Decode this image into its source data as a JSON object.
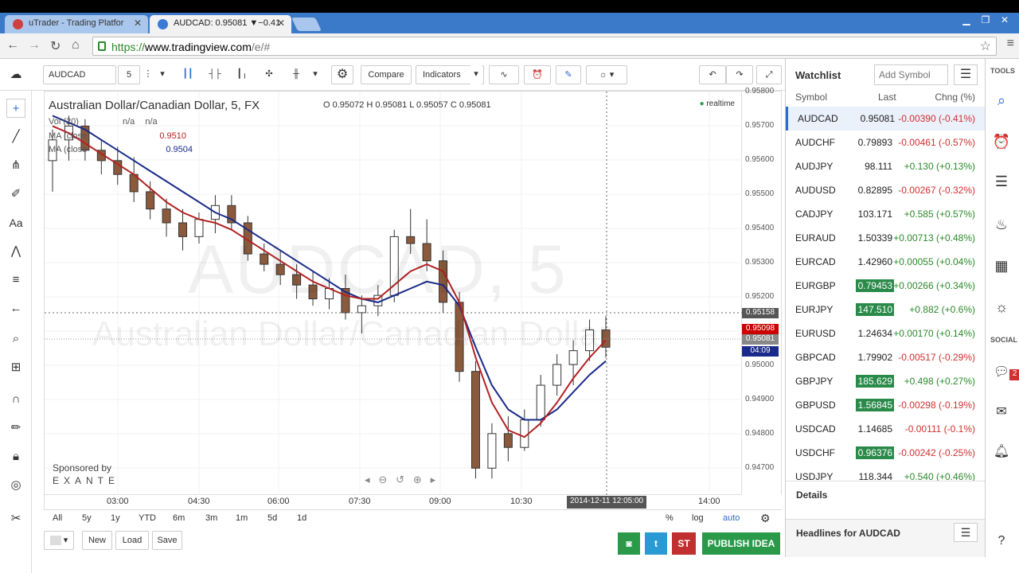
{
  "browser": {
    "tabs": [
      {
        "label": "uTrader - Trading Platfor"
      },
      {
        "label": "AUDCAD: 0.95081 ▼−0.41"
      }
    ],
    "url_proto": "https://",
    "url_host": "www.tradingview.com",
    "url_rest": "/e/#"
  },
  "toolbar": {
    "symbol": "AUDCAD",
    "interval": "5",
    "compare_label": "Compare",
    "indicators_label": "Indicators"
  },
  "legend": {
    "title": "Australian Dollar/Canadian Dollar, 5, FX",
    "ohlc": "O 0.95072 H 0.95081 L 0.95057 C 0.95081",
    "realtime": "realtime",
    "vol_label": "Vol (20)",
    "vol_val1": "n/a",
    "vol_val2": "n/a",
    "ma1_label": "MA (close",
    "ma1_val": "0.9510",
    "ma2_label": "MA (close",
    "ma2_val": "0.9504",
    "watermark_symbol": "AUDCAD, 5",
    "watermark_name": "Australian Dollar/Canadian Dollar",
    "sponsored": "Sponsored by",
    "sponsor": "EXANTE"
  },
  "price_axis": [
    "0.95800",
    "0.95700",
    "0.95600",
    "0.95500",
    "0.95400",
    "0.95300",
    "0.95200",
    "0.95100",
    "0.95000",
    "0.94900",
    "0.94800",
    "0.94700"
  ],
  "price_tags": {
    "crosshair": "0.95158",
    "ma_red": "0.95098",
    "last": "0.95081",
    "countdown": "04:09"
  },
  "time_axis": [
    "03:00",
    "04:30",
    "06:00",
    "07:30",
    "09:00",
    "10:30",
    "14:00"
  ],
  "time_tag": "2014-12-11 12:05:00",
  "ranges": [
    "All",
    "5y",
    "1y",
    "YTD",
    "6m",
    "3m",
    "1m",
    "5d",
    "1d"
  ],
  "scale_opts": {
    "pct": "%",
    "log": "log",
    "auto": "auto"
  },
  "bottom": {
    "new_label": "New",
    "load_label": "Load",
    "save_label": "Save",
    "publish_label": "PUBLISH IDEA",
    "st_label": "ST"
  },
  "watchlist": {
    "title": "Watchlist",
    "add_placeholder": "Add Symbol",
    "col_symbol": "Symbol",
    "col_last": "Last",
    "col_chg": "Chng (%)",
    "rows": [
      {
        "sym": "AUDCAD",
        "last": "0.95081",
        "chg": "-0.00390 (-0.41%)",
        "dir": "neg",
        "hl": false
      },
      {
        "sym": "AUDCHF",
        "last": "0.79893",
        "chg": "-0.00461 (-0.57%)",
        "dir": "neg",
        "hl": false
      },
      {
        "sym": "AUDJPY",
        "last": "98.111",
        "chg": "+0.130 (+0.13%)",
        "dir": "pos",
        "hl": false
      },
      {
        "sym": "AUDUSD",
        "last": "0.82895",
        "chg": "-0.00267 (-0.32%)",
        "dir": "neg",
        "hl": false
      },
      {
        "sym": "CADJPY",
        "last": "103.171",
        "chg": "+0.585 (+0.57%)",
        "dir": "pos",
        "hl": false
      },
      {
        "sym": "EURAUD",
        "last": "1.50339",
        "chg": "+0.00713 (+0.48%)",
        "dir": "pos",
        "hl": false
      },
      {
        "sym": "EURCAD",
        "last": "1.42960",
        "chg": "+0.00055 (+0.04%)",
        "dir": "pos",
        "hl": false
      },
      {
        "sym": "EURGBP",
        "last": "0.79453",
        "chg": "+0.00266 (+0.34%)",
        "dir": "pos",
        "hl": true
      },
      {
        "sym": "EURJPY",
        "last": "147.510",
        "chg": "+0.882 (+0.6%)",
        "dir": "pos",
        "hl": true
      },
      {
        "sym": "EURUSD",
        "last": "1.24634",
        "chg": "+0.00170 (+0.14%)",
        "dir": "pos",
        "hl": false
      },
      {
        "sym": "GBPCAD",
        "last": "1.79902",
        "chg": "-0.00517 (-0.29%)",
        "dir": "neg",
        "hl": false
      },
      {
        "sym": "GBPJPY",
        "last": "185.629",
        "chg": "+0.498 (+0.27%)",
        "dir": "pos",
        "hl": true
      },
      {
        "sym": "GBPUSD",
        "last": "1.56845",
        "chg": "-0.00298 (-0.19%)",
        "dir": "neg",
        "hl": true
      },
      {
        "sym": "USDCAD",
        "last": "1.14685",
        "chg": "-0.00111 (-0.1%)",
        "dir": "neg",
        "hl": false
      },
      {
        "sym": "USDCHF",
        "last": "0.96376",
        "chg": "-0.00242 (-0.25%)",
        "dir": "neg",
        "hl": true
      },
      {
        "sym": "USDJPY",
        "last": "118.344",
        "chg": "+0.540 (+0.46%)",
        "dir": "pos",
        "hl": false
      }
    ],
    "details_label": "Details",
    "headlines_label": "Headlines for AUDCAD"
  },
  "right_tools": {
    "tools_label": "TOOLS",
    "social_label": "SOCIAL",
    "badge": "2"
  },
  "colors": {
    "candle_up": "#ffffff",
    "candle_down": "#8b5a3c",
    "ma_red": "#b22222",
    "ma_blue": "#1a2a8a",
    "accent_green": "#2a9a4a",
    "chrome_blue": "#3b79c9"
  },
  "chart_data": {
    "type": "candlestick",
    "ylim": [
      0.9465,
      0.9582
    ],
    "candles": [
      [
        0.9562,
        0.9571,
        0.9553,
        0.9568
      ],
      [
        0.9568,
        0.9575,
        0.9562,
        0.9572
      ],
      [
        0.9572,
        0.9574,
        0.9562,
        0.9565
      ],
      [
        0.9565,
        0.9568,
        0.9558,
        0.9562
      ],
      [
        0.9562,
        0.9566,
        0.9555,
        0.9558
      ],
      [
        0.9558,
        0.9563,
        0.955,
        0.9553
      ],
      [
        0.9553,
        0.9556,
        0.9545,
        0.9548
      ],
      [
        0.9548,
        0.9551,
        0.954,
        0.9544
      ],
      [
        0.9544,
        0.9548,
        0.9536,
        0.954
      ],
      [
        0.954,
        0.9547,
        0.9538,
        0.9545
      ],
      [
        0.9545,
        0.9552,
        0.9541,
        0.9549
      ],
      [
        0.9549,
        0.9552,
        0.9542,
        0.9544
      ],
      [
        0.9544,
        0.9546,
        0.9533,
        0.9535
      ],
      [
        0.9535,
        0.9538,
        0.953,
        0.9532
      ],
      [
        0.9532,
        0.9536,
        0.9526,
        0.9529
      ],
      [
        0.9529,
        0.9532,
        0.9522,
        0.9526
      ],
      [
        0.9526,
        0.953,
        0.952,
        0.9522
      ],
      [
        0.9522,
        0.9528,
        0.9519,
        0.9525
      ],
      [
        0.9525,
        0.9529,
        0.9516,
        0.9518
      ],
      [
        0.9518,
        0.9523,
        0.9512,
        0.952
      ],
      [
        0.952,
        0.9526,
        0.9517,
        0.9523
      ],
      [
        0.9523,
        0.9542,
        0.9521,
        0.954
      ],
      [
        0.954,
        0.9548,
        0.9535,
        0.9538
      ],
      [
        0.9538,
        0.9545,
        0.953,
        0.9533
      ],
      [
        0.9533,
        0.9536,
        0.9518,
        0.9521
      ],
      [
        0.9521,
        0.9524,
        0.9498,
        0.9501
      ],
      [
        0.9501,
        0.9504,
        0.947,
        0.9473
      ],
      [
        0.9473,
        0.9486,
        0.947,
        0.9483
      ],
      [
        0.9483,
        0.9488,
        0.9475,
        0.9479
      ],
      [
        0.9479,
        0.949,
        0.9478,
        0.9487
      ],
      [
        0.9487,
        0.95,
        0.9485,
        0.9497
      ],
      [
        0.9497,
        0.9506,
        0.9494,
        0.9503
      ],
      [
        0.9503,
        0.951,
        0.9497,
        0.9507
      ],
      [
        0.9507,
        0.9516,
        0.9504,
        0.9513
      ],
      [
        0.9513,
        0.9517,
        0.9505,
        0.9508
      ]
    ],
    "ma_red": [
      0.9572,
      0.957,
      0.9567,
      0.9564,
      0.9561,
      0.9558,
      0.9554,
      0.955,
      0.9547,
      0.9545,
      0.9544,
      0.9542,
      0.9539,
      0.9536,
      0.9533,
      0.953,
      0.9527,
      0.9525,
      0.9523,
      0.9522,
      0.9522,
      0.9526,
      0.953,
      0.9532,
      0.953,
      0.9521,
      0.9505,
      0.9492,
      0.9484,
      0.9482,
      0.9486,
      0.9492,
      0.9499,
      0.9505,
      0.951
    ],
    "ma_blue": [
      0.9575,
      0.9573,
      0.9571,
      0.9568,
      0.9565,
      0.9562,
      0.9559,
      0.9556,
      0.9553,
      0.955,
      0.9547,
      0.9545,
      0.9542,
      0.9539,
      0.9536,
      0.9533,
      0.953,
      0.9527,
      0.9524,
      0.9522,
      0.9521,
      0.9523,
      0.9525,
      0.9527,
      0.9526,
      0.952,
      0.9508,
      0.9497,
      0.949,
      0.9487,
      0.9487,
      0.949,
      0.9495,
      0.95,
      0.9504
    ]
  }
}
